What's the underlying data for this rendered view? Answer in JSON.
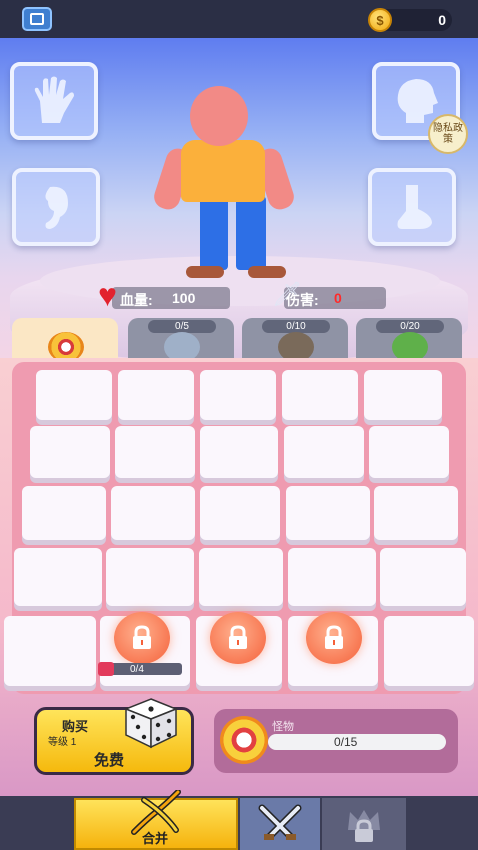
{
  "topbar": {
    "coins": "0",
    "coin_symbol": "$"
  },
  "stats": {
    "hp_label": "血量:",
    "hp_value": "100",
    "dmg_label": "伤害:",
    "dmg_value": "0"
  },
  "privacy": {
    "label": "隐私政策"
  },
  "categories": [
    {
      "progress": "",
      "selected": true
    },
    {
      "progress": "0/5",
      "selected": false
    },
    {
      "progress": "0/10",
      "selected": false
    },
    {
      "progress": "0/20",
      "selected": false
    }
  ],
  "board": {
    "unlock_progress": "0/4"
  },
  "buy": {
    "title": "购买",
    "level": "等级 1",
    "price": "免费"
  },
  "monster": {
    "label": "怪物",
    "count": "0/15"
  },
  "nav": {
    "merge_label": "合并"
  },
  "colors": {
    "accent": "#f5b90d",
    "board": "#ef9bb0",
    "hp_heart": "#e2222e",
    "dmg_value": "#ff2a2a"
  }
}
